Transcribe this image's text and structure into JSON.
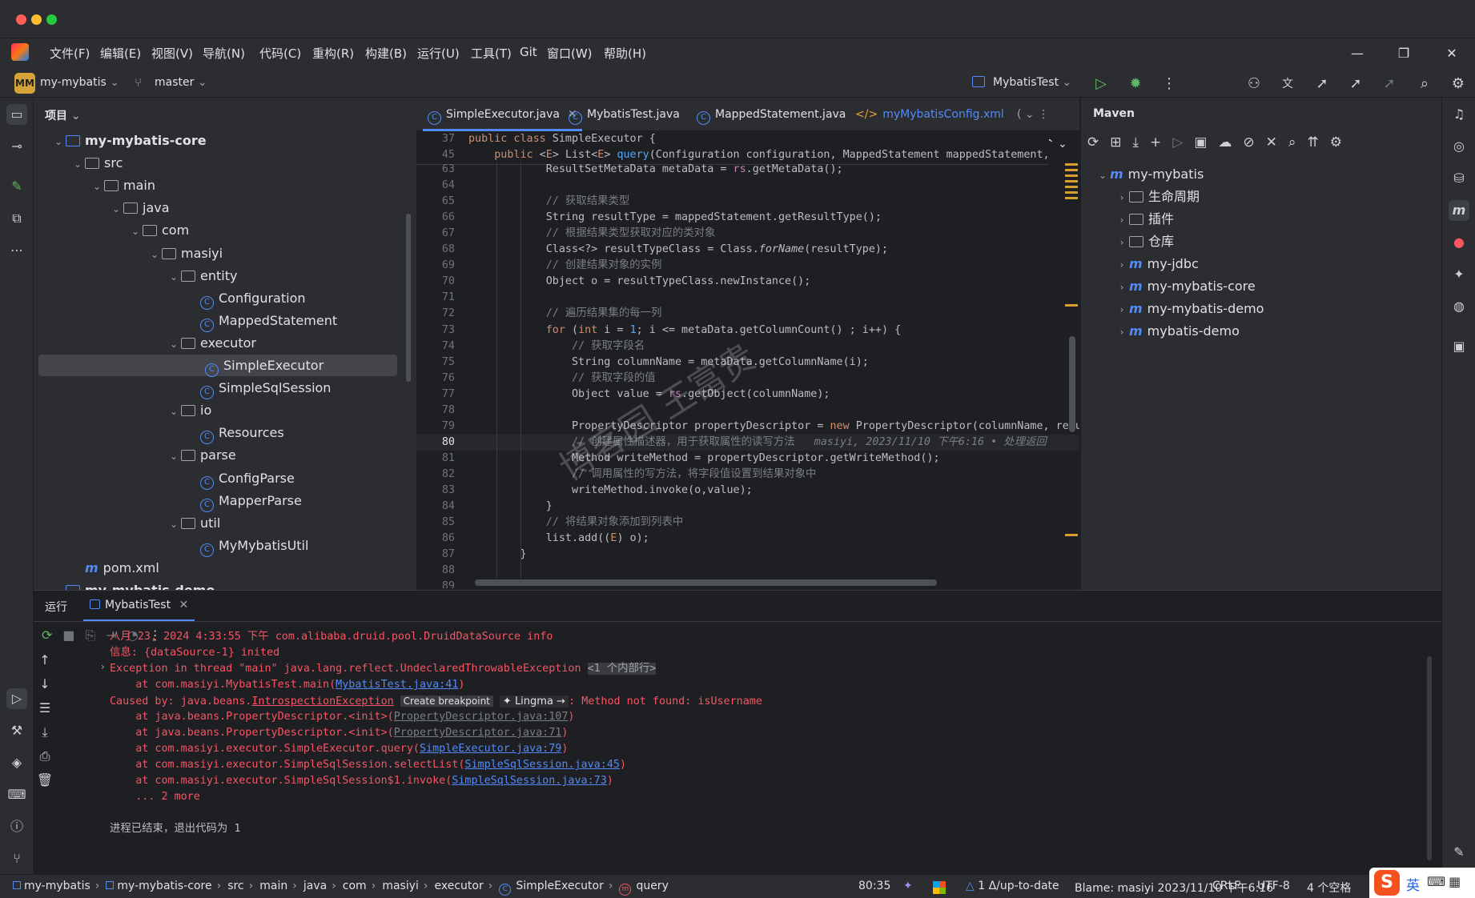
{
  "menu": [
    "文件(F)",
    "编辑(E)",
    "视图(V)",
    "导航(N)",
    "代码(C)",
    "重构(R)",
    "构建(B)",
    "运行(U)",
    "工具(T)",
    "Git",
    "窗口(W)",
    "帮助(H)"
  ],
  "toolbar": {
    "project_badge": "MM",
    "project": "my-mybatis",
    "branch": "master",
    "run_config": "MybatisTest"
  },
  "project_panel": {
    "title": "项目",
    "tree": [
      {
        "label": "my-mybatis-core",
        "indent": 0,
        "type": "module",
        "open": true,
        "bold": true
      },
      {
        "label": "src",
        "indent": 1,
        "type": "folder",
        "open": true
      },
      {
        "label": "main",
        "indent": 2,
        "type": "folder",
        "open": true
      },
      {
        "label": "java",
        "indent": 3,
        "type": "folder",
        "open": true
      },
      {
        "label": "com",
        "indent": 4,
        "type": "package",
        "open": true
      },
      {
        "label": "masiyi",
        "indent": 5,
        "type": "package",
        "open": true
      },
      {
        "label": "entity",
        "indent": 6,
        "type": "package",
        "open": true
      },
      {
        "label": "Configuration",
        "indent": 7,
        "type": "class"
      },
      {
        "label": "MappedStatement",
        "indent": 7,
        "type": "class"
      },
      {
        "label": "executor",
        "indent": 6,
        "type": "package",
        "open": true
      },
      {
        "label": "SimpleExecutor",
        "indent": 7,
        "type": "class",
        "selected": true
      },
      {
        "label": "SimpleSqlSession",
        "indent": 7,
        "type": "class"
      },
      {
        "label": "io",
        "indent": 6,
        "type": "package",
        "open": true
      },
      {
        "label": "Resources",
        "indent": 7,
        "type": "class"
      },
      {
        "label": "parse",
        "indent": 6,
        "type": "package",
        "open": true
      },
      {
        "label": "ConfigParse",
        "indent": 7,
        "type": "class"
      },
      {
        "label": "MapperParse",
        "indent": 7,
        "type": "class"
      },
      {
        "label": "util",
        "indent": 6,
        "type": "package",
        "open": true
      },
      {
        "label": "MyMybatisUtil",
        "indent": 7,
        "type": "class"
      },
      {
        "label": "pom.xml",
        "indent": 1,
        "type": "maven"
      },
      {
        "label": "my-mybatis-demo",
        "indent": 0,
        "type": "module",
        "open": true,
        "bold": true
      }
    ]
  },
  "tabs": [
    {
      "label": "SimpleExecutor.java",
      "active": true
    },
    {
      "label": "MybatisTest.java"
    },
    {
      "label": "MappedStatement.java"
    },
    {
      "label": "myMybatisConfig.xml"
    }
  ],
  "inspections": {
    "warnings": "10",
    "ok": "1"
  },
  "sticky": [
    {
      "ln": "37",
      "html": "<span class='kw'>public class</span> SimpleExecutor {"
    },
    {
      "ln": "45",
      "html": "    <span class='kw'>public</span> &lt;<span class='kw'>E</span>&gt; List&lt;<span class='kw'>E</span>&gt; <span class='fn'>query</span>(Configuration configuration, MappedStatement mappedStatement, Obje"
    }
  ],
  "code": [
    {
      "ln": "63",
      "html": "            ResultSetMetaData metaData = <span class='var'>rs</span>.getMetaData();"
    },
    {
      "ln": "64",
      "html": ""
    },
    {
      "ln": "65",
      "html": "            <span class='cm'>// 获取结果类型</span>"
    },
    {
      "ln": "66",
      "html": "            String resultType = mappedStatement.getResultType();"
    },
    {
      "ln": "67",
      "html": "            <span class='cm'>// 根据结果类型获取对应的类对象</span>"
    },
    {
      "ln": "68",
      "html": "            Class&lt;?&gt; resultTypeClass = Class.<span class='it'>forName</span>(resultType);"
    },
    {
      "ln": "69",
      "html": "            <span class='cm'>// 创建结果对象的实例</span>"
    },
    {
      "ln": "70",
      "html": "            Object o = resultTypeClass.newInstance();"
    },
    {
      "ln": "71",
      "html": ""
    },
    {
      "ln": "72",
      "html": "            <span class='cm'>// 遍历结果集的每一列</span>"
    },
    {
      "ln": "73",
      "html": "            <span class='kw'>for</span> (<span class='kw'>int</span> i = <span class='fn'>1</span>; i &lt;= metaData.getColumnCount() ; i++) {"
    },
    {
      "ln": "74",
      "html": "                <span class='cm'>// 获取字段名</span>"
    },
    {
      "ln": "75",
      "html": "                String columnName = metaData.getColumnName(i);"
    },
    {
      "ln": "76",
      "html": "                <span class='cm'>// 获取字段的值</span>"
    },
    {
      "ln": "77",
      "html": "                Object value = <span class='var'>rs</span>.getObject(columnName);"
    },
    {
      "ln": "78",
      "html": ""
    },
    {
      "ln": "79",
      "html": "                PropertyDescriptor propertyDescriptor = <span class='kw'>new</span> PropertyDescriptor(columnName, resu"
    },
    {
      "ln": "80",
      "html": "                <span class='cm'>// 创建属性描述器，用于获取属性的读写方法   <span class='it'>masiyi, 2023/11/10 下午6:16 • 处理返回</span></span>"
    },
    {
      "ln": "81",
      "html": "                Method writeMethod = propertyDescriptor.getWriteMethod();"
    },
    {
      "ln": "82",
      "html": "                <span class='cm'>// 调用属性的写方法，将字段值设置到结果对象中</span>"
    },
    {
      "ln": "83",
      "html": "                writeMethod.invoke(o,value);"
    },
    {
      "ln": "84",
      "html": "            }"
    },
    {
      "ln": "85",
      "html": "            <span class='cm'>// 将结果对象添加到列表中</span>"
    },
    {
      "ln": "86",
      "html": "            list.add((<span class='kw'>E</span>) o);"
    },
    {
      "ln": "87",
      "html": "        }"
    },
    {
      "ln": "88",
      "html": ""
    },
    {
      "ln": "89",
      "html": ""
    }
  ],
  "maven": {
    "title": "Maven",
    "root": "my-mybatis",
    "items": [
      {
        "label": "生命周期",
        "type": "folder"
      },
      {
        "label": "插件",
        "type": "folder"
      },
      {
        "label": "仓库",
        "type": "folder"
      },
      {
        "label": "my-jdbc",
        "type": "m"
      },
      {
        "label": "my-mybatis-core",
        "type": "m"
      },
      {
        "label": "my-mybatis-demo",
        "type": "m"
      },
      {
        "label": "mybatis-demo",
        "type": "m"
      }
    ]
  },
  "run": {
    "title": "运行",
    "tab": "MybatisTest",
    "lines": [
      {
        "html": "八月 23, 2024 4:33:55 下午 com.alibaba.druid.pool.DruidDataSource info"
      },
      {
        "html": "信息: {dataSource-1} inited"
      },
      {
        "html": "Exception in thread \"main\" java.lang.reflect.UndeclaredThrowableException <span style='background:#393b40;color:#a0a3a8'>&lt;1 个内部行&gt;</span>"
      },
      {
        "html": "    at com.masiyi.MybatisTest.main(<span class='lnk'>MybatisTest.java:41</span>)"
      },
      {
        "html": "Caused by: java.beans.<span style='text-decoration:underline'>IntrospectionException</span> <span style='background:#393b40;color:#dfe1e5;font-family:DejaVu Sans,sans-serif;font-size:12px'> Create breakpoint </span> <span style='background:#2b2d30;color:#dfe1e5;font-family:DejaVu Sans,sans-serif;font-size:13px'> ✦ Lingma → </span>: Method not found: isUsername"
      },
      {
        "html": "    at java.beans.PropertyDescriptor.&lt;init&gt;(<span class='lnk' style='color:#7a7e85'>PropertyDescriptor.java:107</span>)"
      },
      {
        "html": "    at java.beans.PropertyDescriptor.&lt;init&gt;(<span class='lnk' style='color:#7a7e85'>PropertyDescriptor.java:71</span>)"
      },
      {
        "html": "    at com.masiyi.executor.SimpleExecutor.query(<span class='lnk'>SimpleExecutor.java:79</span>)"
      },
      {
        "html": "    at com.masiyi.executor.SimpleSqlSession.selectList(<span class='lnk'>SimpleSqlSession.java:45</span>)"
      },
      {
        "html": "    at com.masiyi.executor.SimpleSqlSession$1.invoke(<span class='lnk'>SimpleSqlSession.java:73</span>)"
      },
      {
        "html": "    ... 2 more"
      },
      {
        "html": ""
      },
      {
        "html": "<span style='color:#bcbec4'>进程已结束，退出代码为 1</span>"
      }
    ]
  },
  "status": {
    "crumbs": [
      "my-mybatis",
      "my-mybatis-core",
      "src",
      "main",
      "java",
      "com",
      "masiyi",
      "executor",
      "SimpleExecutor",
      "query"
    ],
    "position": "80:35",
    "vcs": "1 Δ/up-to-date",
    "blame": "Blame: masiyi 2023/11/10 下午6:16",
    "line_sep": "CRLF",
    "encoding": "UTF-8",
    "indent": "4 个空格",
    "ime": "英"
  },
  "watermark": "博客园 王富贵",
  "colors": {
    "accent": "#548af7",
    "error": "#f75464",
    "run": "#5fb865",
    "warning": "#f2c55c"
  }
}
